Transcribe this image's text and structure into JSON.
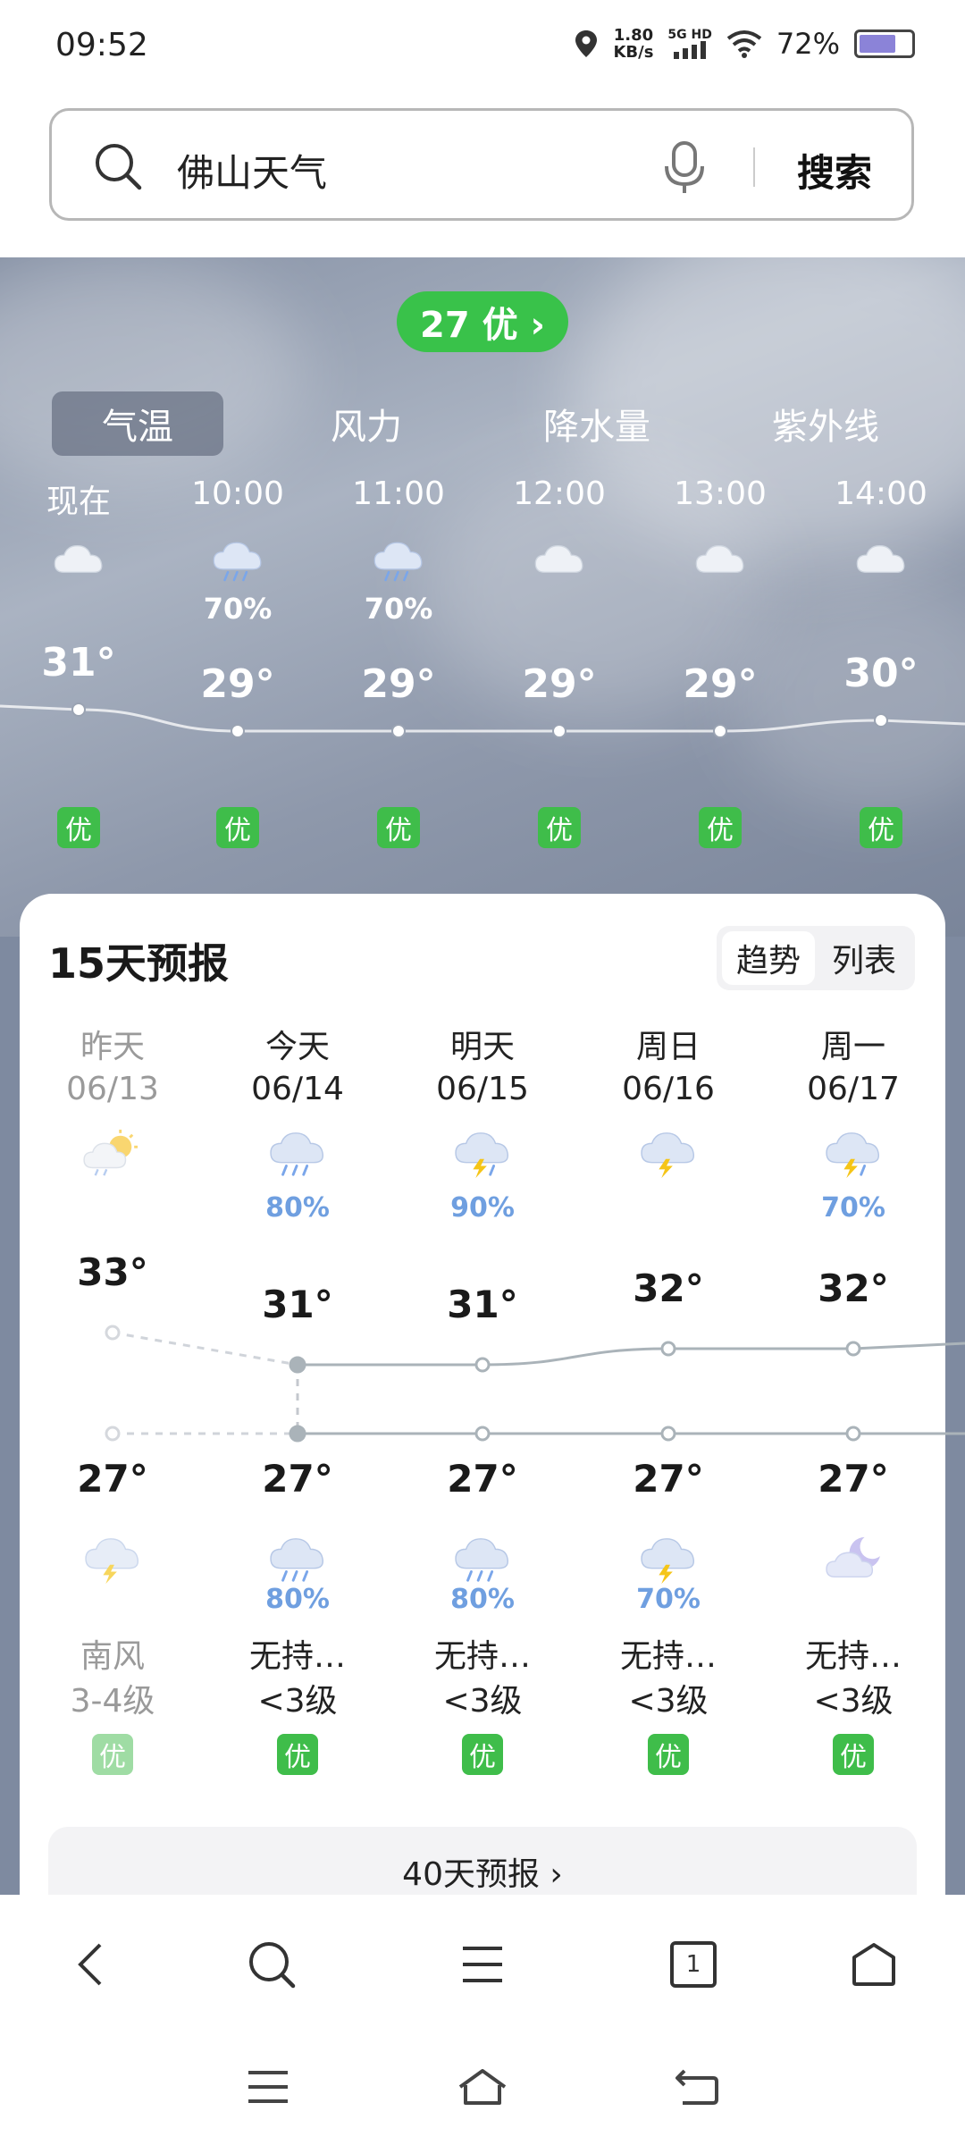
{
  "status_bar": {
    "time": "09:52",
    "net_speed_value": "1.80",
    "net_speed_unit": "KB/s",
    "net_type_top": "5G HD",
    "battery": "72%",
    "battery_level": 0.72
  },
  "search": {
    "query": "佛山天气",
    "button": "搜索"
  },
  "hero": {
    "aqi": "27 优 ›",
    "tabs": [
      {
        "label": "气温"
      },
      {
        "label": "风力"
      },
      {
        "label": "降水量"
      },
      {
        "label": "紫外线"
      }
    ],
    "hours": [
      {
        "time": "现在",
        "temp": "31°",
        "pct": "",
        "icon": "cloud-icon",
        "aqi": "优"
      },
      {
        "time": "10:00",
        "temp": "29°",
        "pct": "70%",
        "icon": "rain-cloud-icon",
        "aqi": "优"
      },
      {
        "time": "11:00",
        "temp": "29°",
        "pct": "70%",
        "icon": "rain-cloud-icon",
        "aqi": "优"
      },
      {
        "time": "12:00",
        "temp": "29°",
        "pct": "",
        "icon": "cloud-icon",
        "aqi": "优"
      },
      {
        "time": "13:00",
        "temp": "29°",
        "pct": "",
        "icon": "cloud-icon",
        "aqi": "优"
      },
      {
        "time": "14:00",
        "temp": "30°",
        "pct": "",
        "icon": "cloud-icon",
        "aqi": "优"
      }
    ]
  },
  "forecast": {
    "title": "15天预报",
    "trend_label": "趋势",
    "list_label": "列表",
    "days": [
      {
        "name": "昨天",
        "date": "06/13",
        "day_icon": "sun-cloud-icon",
        "day_pct": "",
        "high": "33°",
        "low": "27°",
        "night_icon": "thunder-cloud-icon",
        "night_pct": "",
        "wind": "南风",
        "level": "3-4级",
        "aqi": "优"
      },
      {
        "name": "今天",
        "date": "06/14",
        "day_icon": "rain-cloud-icon",
        "day_pct": "80%",
        "high": "31°",
        "low": "27°",
        "night_icon": "rain-cloud-icon",
        "night_pct": "80%",
        "wind": "无持…",
        "level": "<3级",
        "aqi": "优"
      },
      {
        "name": "明天",
        "date": "06/15",
        "day_icon": "thunder-rain-icon",
        "day_pct": "90%",
        "high": "31°",
        "low": "27°",
        "night_icon": "rain-cloud-icon",
        "night_pct": "80%",
        "wind": "无持…",
        "level": "<3级",
        "aqi": "优"
      },
      {
        "name": "周日",
        "date": "06/16",
        "day_icon": "thunder-cloud-icon",
        "day_pct": "",
        "high": "32°",
        "low": "27°",
        "night_icon": "thunder-cloud-icon",
        "night_pct": "70%",
        "wind": "无持…",
        "level": "<3级",
        "aqi": "优"
      },
      {
        "name": "周一",
        "date": "06/17",
        "day_icon": "thunder-rain-icon",
        "day_pct": "70%",
        "high": "32°",
        "low": "27°",
        "night_icon": "moon-cloud-icon",
        "night_pct": "",
        "wind": "无持…",
        "level": "<3级",
        "aqi": "优"
      }
    ],
    "forty_day": "40天预报 ›"
  },
  "toolbar": {
    "tab_count": "1"
  }
}
